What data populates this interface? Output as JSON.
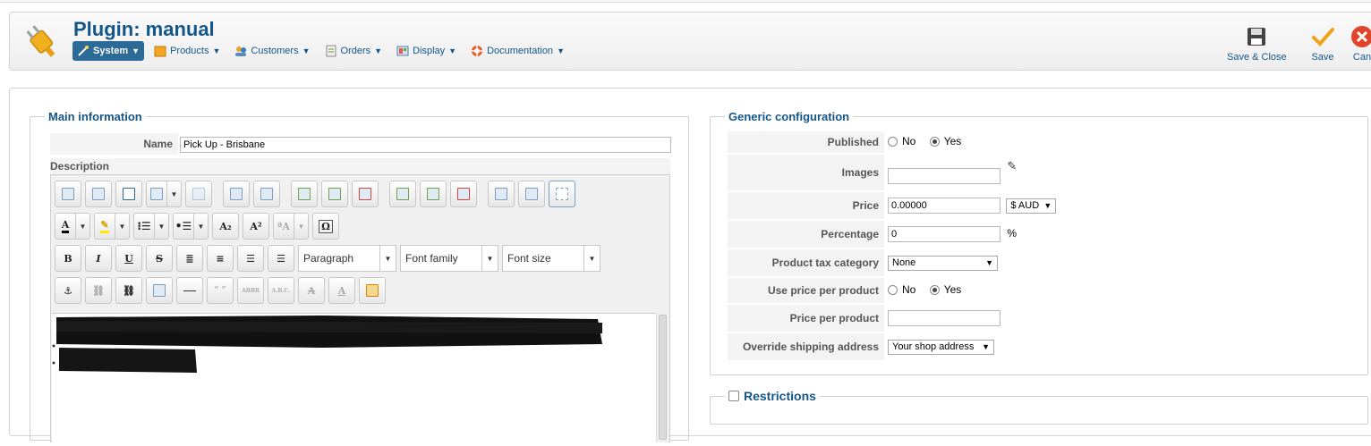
{
  "header": {
    "title": "Plugin: manual",
    "menu": [
      {
        "label": "System",
        "icon": "wand-icon"
      },
      {
        "label": "Products",
        "icon": "box-icon"
      },
      {
        "label": "Customers",
        "icon": "users-icon"
      },
      {
        "label": "Orders",
        "icon": "orders-icon"
      },
      {
        "label": "Display",
        "icon": "display-icon"
      },
      {
        "label": "Documentation",
        "icon": "lifebuoy-icon"
      }
    ],
    "toolbar": {
      "save_close": "Save & Close",
      "save": "Save",
      "cancel": "Can"
    }
  },
  "main_info": {
    "legend": "Main information",
    "name_label": "Name",
    "name_value": "Pick Up - Brisbane",
    "description_label": "Description",
    "format_select": "Paragraph",
    "font_family_select": "Font family",
    "font_size_select": "Font size"
  },
  "generic": {
    "legend": "Generic configuration",
    "published_label": "Published",
    "no": "No",
    "yes": "Yes",
    "images_label": "Images",
    "price_label": "Price",
    "price_value": "0.00000",
    "currency": "$ AUD",
    "percentage_label": "Percentage",
    "percentage_value": "0",
    "percent_sign": "%",
    "tax_label": "Product tax category",
    "tax_value": "None",
    "use_price_label": "Use price per product",
    "price_per_product_label": "Price per product",
    "override_label": "Override shipping address",
    "override_value": "Your shop address"
  },
  "restrictions": {
    "legend": "Restrictions"
  },
  "colors": {
    "brand": "#14568a",
    "active_menu": "#2c6a97",
    "save_check": "#f0a21b",
    "cancel": "#e0452b"
  }
}
